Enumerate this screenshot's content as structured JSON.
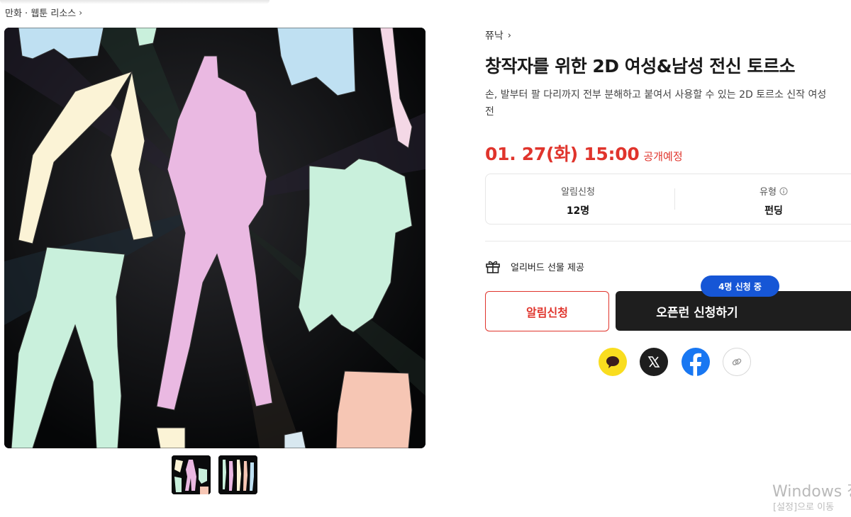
{
  "breadcrumb": {
    "label": "만화 · 웹툰 리소스"
  },
  "product": {
    "creator": "쮸낙",
    "title": "창작자를 위한 2D 여성&남성 전신 토르소",
    "description_line1": "손, 발부터 팔 다리까지 전부 분해하고 붙여서 사용할 수 있는 2D 토르소 신작 여성",
    "description_line2": "전",
    "open_date": "01. 27(화) 15:00",
    "open_status": "공개예정"
  },
  "info": {
    "notify_label": "알림신청",
    "notify_count": "12명",
    "type_label": "유형",
    "type_value": "펀딩"
  },
  "benefit": {
    "label": "얼리버드 선물 제공"
  },
  "buttons": {
    "notify": "알림신청",
    "open_run": "오픈런 신청하기",
    "applicants_pill": "4명 신청 중"
  },
  "share": {
    "icons": [
      "kakao-icon",
      "x-icon",
      "facebook-icon",
      "link-icon"
    ]
  },
  "colors": {
    "accent_red": "#e0342c",
    "dark_button": "#1e1e1e",
    "pill_blue": "#1656d6",
    "kakao_yellow": "#f9dd1f",
    "facebook_blue": "#1877f2"
  },
  "os_watermark": {
    "line1": "Windows 정",
    "line2": "[설정]으로 이동"
  }
}
